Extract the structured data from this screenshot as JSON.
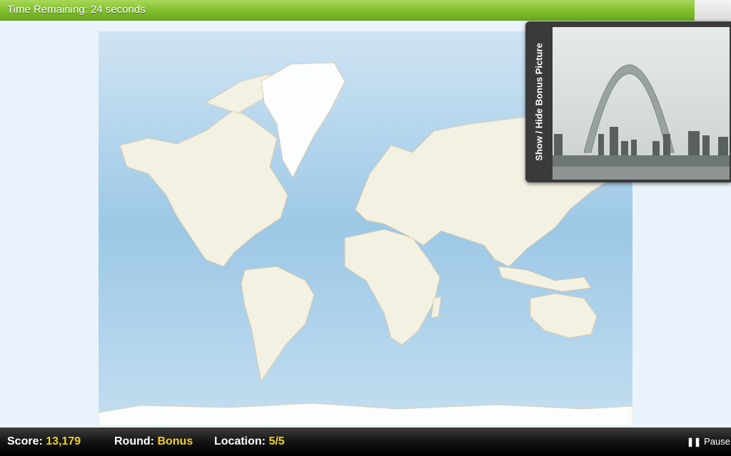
{
  "timer": {
    "label": "Time Remaining: 24 seconds",
    "fraction_remaining": 0.95
  },
  "bonus": {
    "toggle_label": "Show / Hide Bonus Picture",
    "picture_icon": "gateway-arch-photo"
  },
  "map": {
    "icon": "world-map"
  },
  "status": {
    "score_label": "Score:",
    "score_value": "13,179",
    "round_label": "Round:",
    "round_value": "Bonus",
    "location_label": "Location:",
    "location_value": "5/5",
    "pause_label": "Pause",
    "pause_icon": "pause-icon"
  },
  "colors": {
    "value_accent": "#f2d21b",
    "timer_green": "#7fbf2a",
    "ocean": "#9cc8e6",
    "land": "#f3f1e2"
  }
}
